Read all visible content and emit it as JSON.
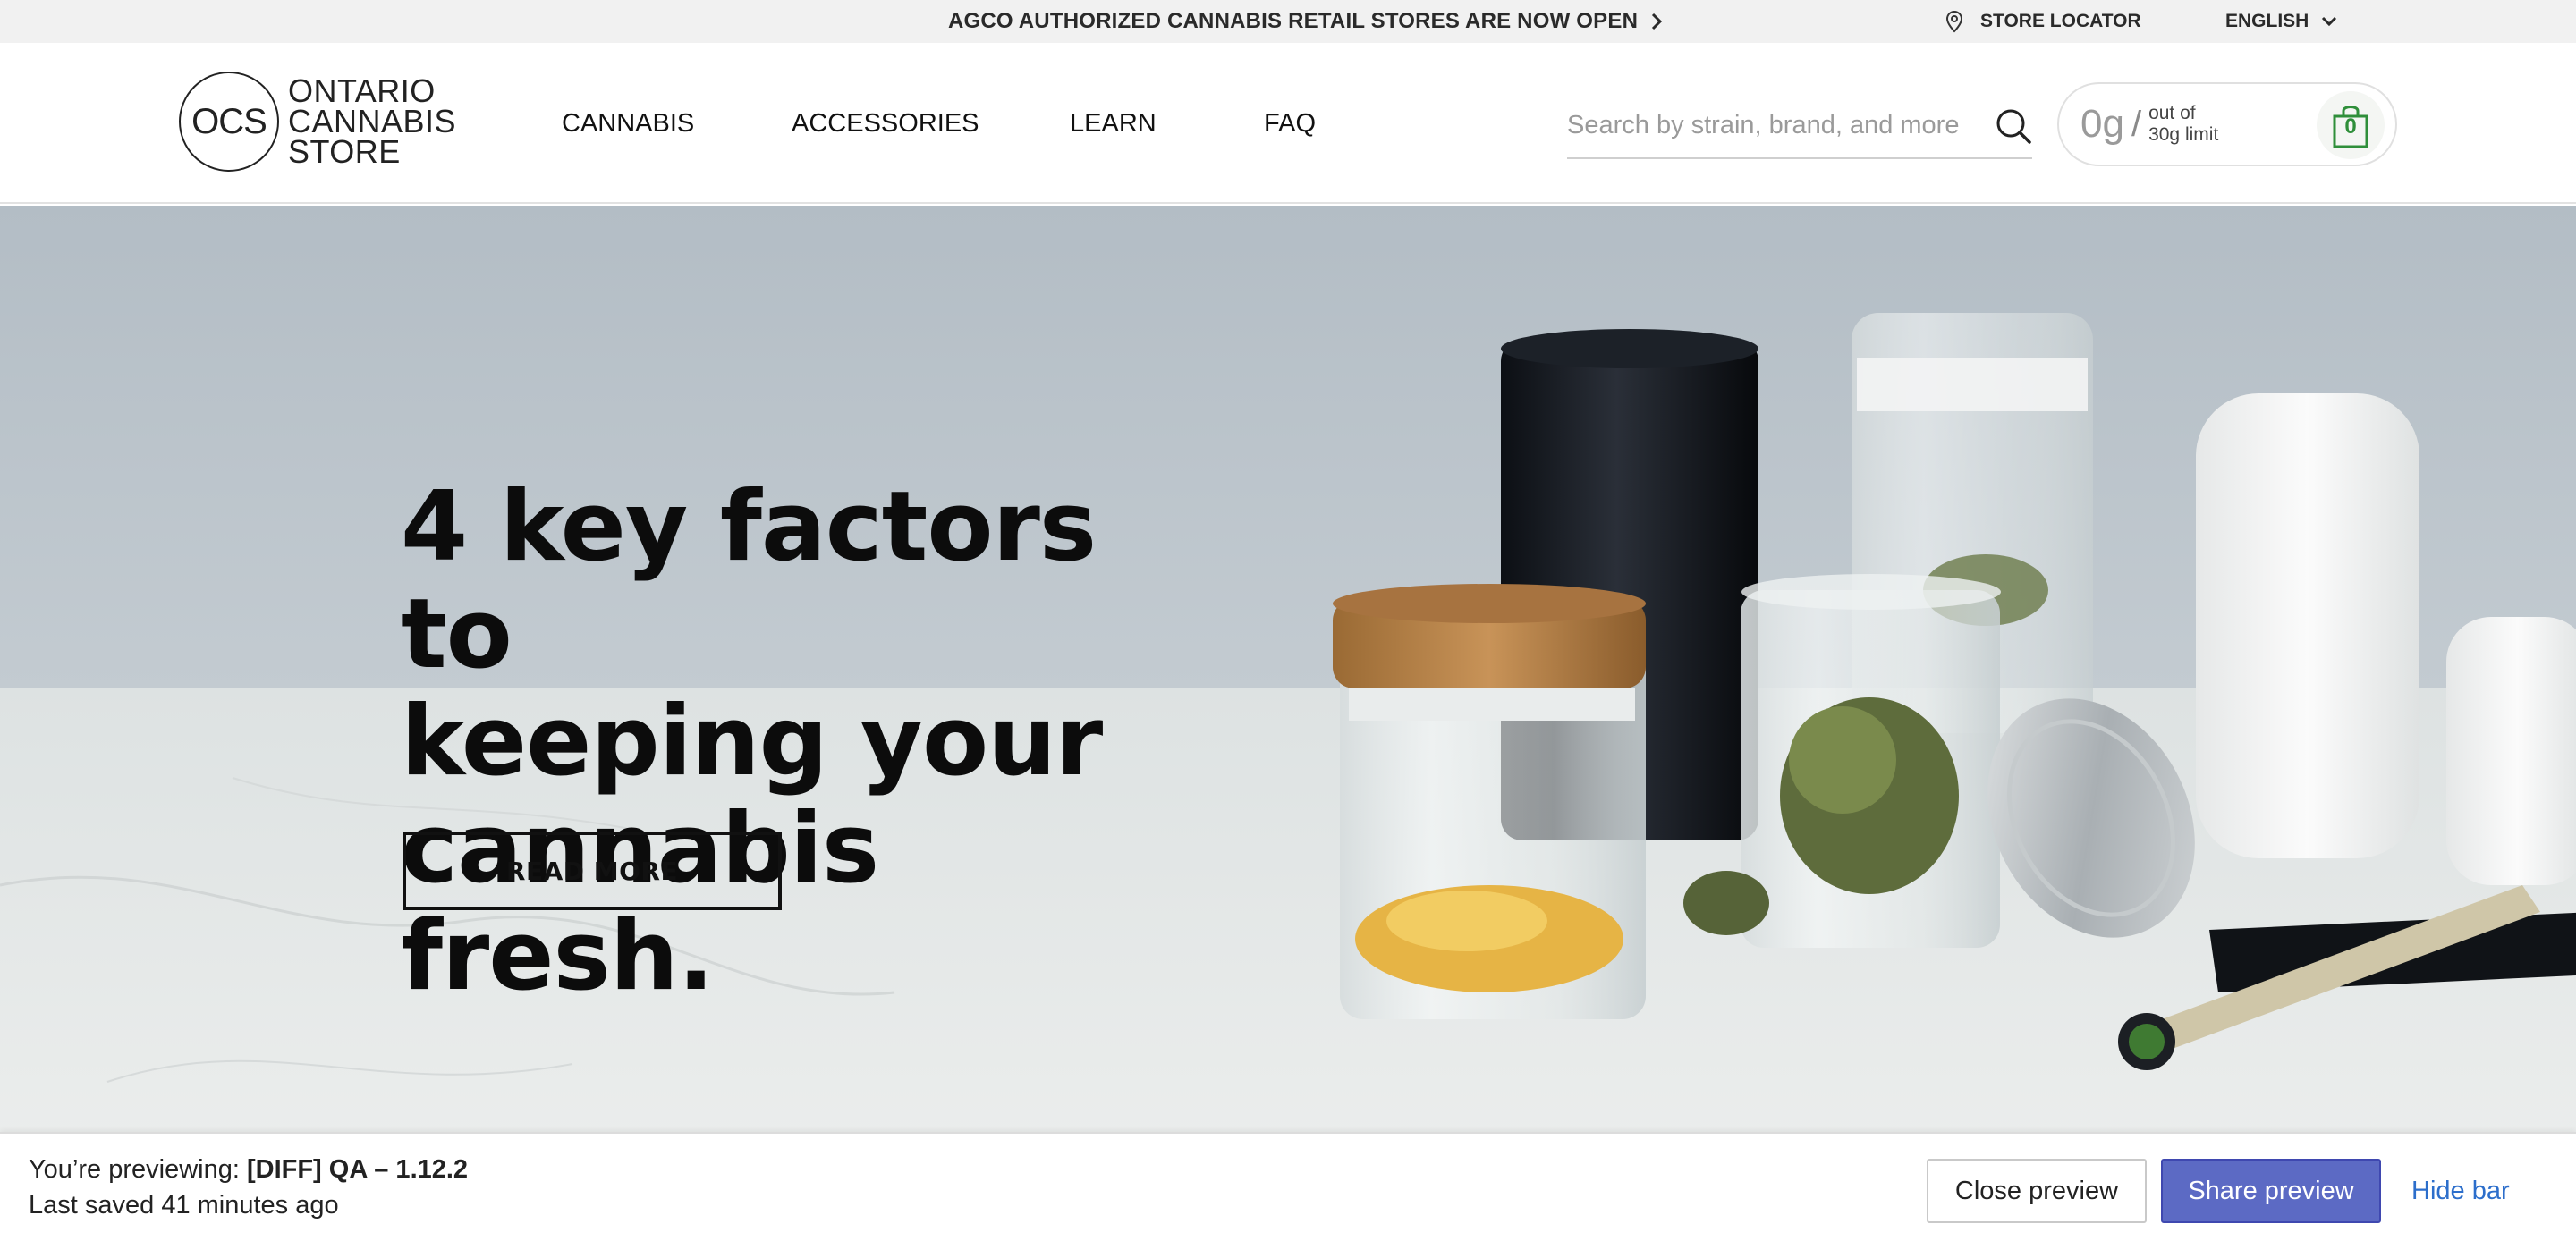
{
  "announcement": {
    "text": "AGCO AUTHORIZED CANNABIS RETAIL STORES ARE NOW OPEN",
    "store_locator": "STORE LOCATOR",
    "language": "ENGLISH"
  },
  "logo": {
    "initials": "OCS",
    "line1": "ONTARIO",
    "line2": "CANNABIS",
    "line3": "STORE"
  },
  "nav": {
    "items": [
      {
        "label": "CANNABIS"
      },
      {
        "label": "ACCESSORIES"
      },
      {
        "label": "LEARN"
      },
      {
        "label": "FAQ"
      }
    ]
  },
  "search": {
    "placeholder": "Search by strain, brand, and more",
    "value": ""
  },
  "cart": {
    "amount": "0g",
    "separator": "/",
    "limit_line1": "out of",
    "limit_line2": "30g limit",
    "count": "0"
  },
  "hero": {
    "title": "4 key factors to\nkeeping your\ncannabis fresh.",
    "button": "READ MORE"
  },
  "preview_bar": {
    "prefix": "You’re previewing:",
    "theme": "[DIFF] QA – 1.12.2",
    "saved": "Last saved 41 minutes ago",
    "close_label": "Close preview",
    "share_label": "Share preview",
    "hide_label": "Hide bar"
  },
  "colors": {
    "accent_green": "#2f8f3a",
    "share_button": "#5c6ac4",
    "link_blue": "#2c6ecb"
  }
}
